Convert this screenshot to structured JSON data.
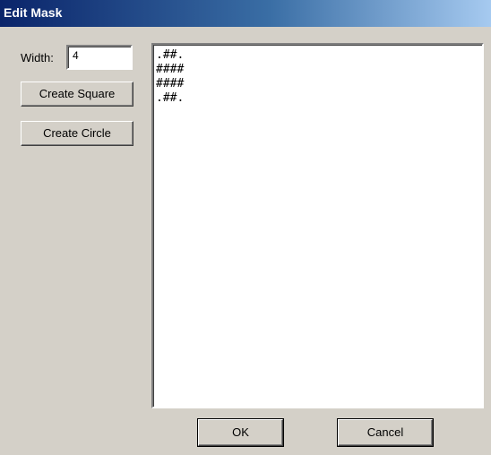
{
  "window": {
    "title": "Edit Mask"
  },
  "width_field": {
    "label": "Width:",
    "value": "4"
  },
  "buttons": {
    "create_square": "Create Square",
    "create_circle": "Create Circle",
    "ok": "OK",
    "cancel": "Cancel"
  },
  "mask": {
    "lines": [
      ".##.",
      "####",
      "####",
      ".##."
    ]
  },
  "colors": {
    "dialog_face": "#d4d0c8",
    "title_gradient_start": "#0a246a",
    "title_gradient_end": "#a6caf0",
    "title_text": "#ffffff"
  }
}
